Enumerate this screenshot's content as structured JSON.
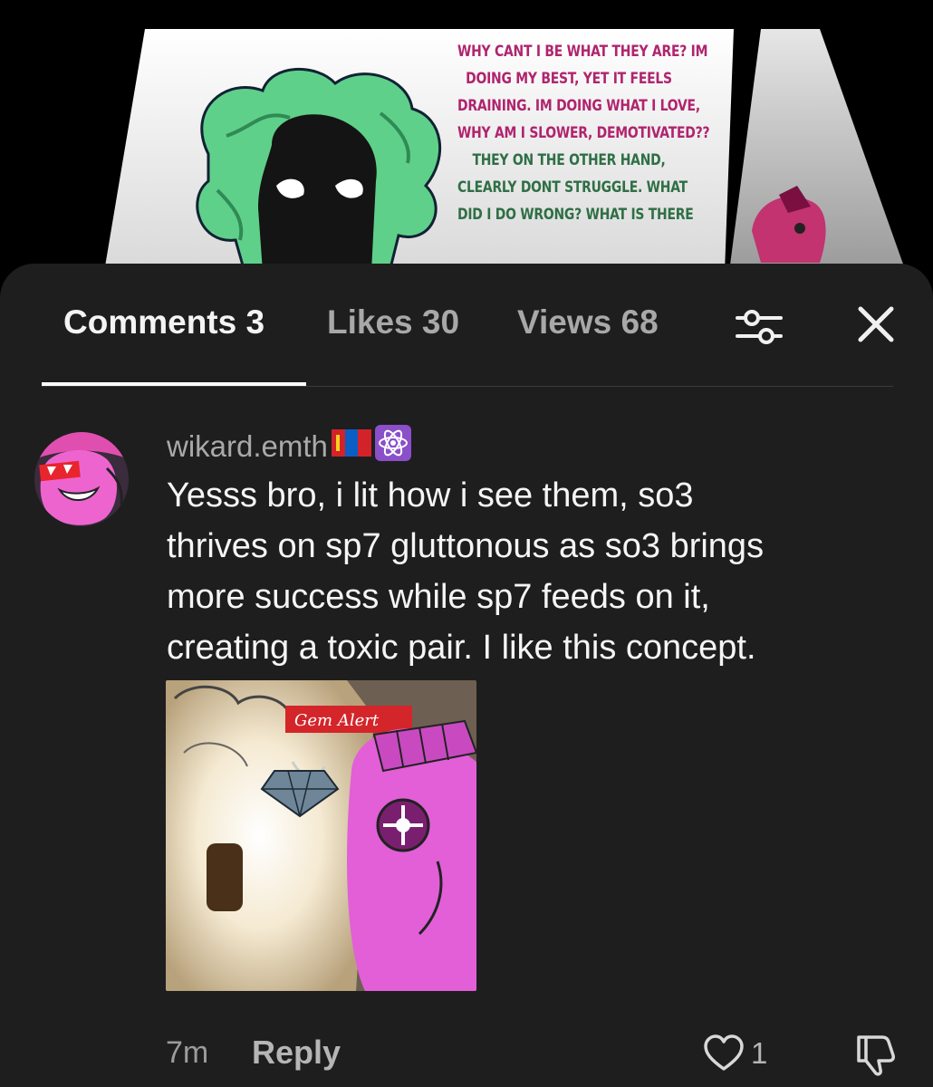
{
  "video": {
    "overlay_lines": [
      {
        "text": "WHY CANT I BE WHAT THEY ARE? IM",
        "color": "pink"
      },
      {
        "text": "DOING MY BEST, YET IT FEELS",
        "color": "pink"
      },
      {
        "text": "DRAINING. IM DOING WHAT I LOVE,",
        "color": "pink"
      },
      {
        "text": "WHY AM I SLOWER, DEMOTIVATED??",
        "color": "pink"
      },
      {
        "text": "THEY ON THE OTHER HAND,",
        "color": "green"
      },
      {
        "text": "CLEARLY DONT STRUGGLE. WHAT",
        "color": "green"
      },
      {
        "text": "DID I DO WRONG? WHAT IS THERE",
        "color": "green"
      }
    ]
  },
  "tabs": [
    {
      "label": "Comments 3",
      "active": true
    },
    {
      "label": "Likes 30",
      "active": false
    },
    {
      "label": "Views 68",
      "active": false
    }
  ],
  "icons": {
    "filter": "sliders-icon",
    "close": "close-icon",
    "like": "heart-icon",
    "dislike": "thumbs-down-icon",
    "flag": "mongolia-flag-icon",
    "atom": "atom-icon"
  },
  "comment": {
    "username": "wikard.emth",
    "body_lines": [
      "Yesss bro, i lit how i see them, so3",
      "thrives on sp7 gluttonous as so3 brings",
      "more success while sp7 feeds on it,",
      "creating a toxic pair. I like this concept."
    ],
    "image_caption": "Gem Alert",
    "timestamp": "7m",
    "reply_label": "Reply",
    "like_count": "1"
  },
  "colors": {
    "sheet_background": "#1e1e1e",
    "overlay_pink": "#b0246e",
    "overlay_green": "#2f6f45",
    "avatar_pink": "#e64fc6"
  }
}
